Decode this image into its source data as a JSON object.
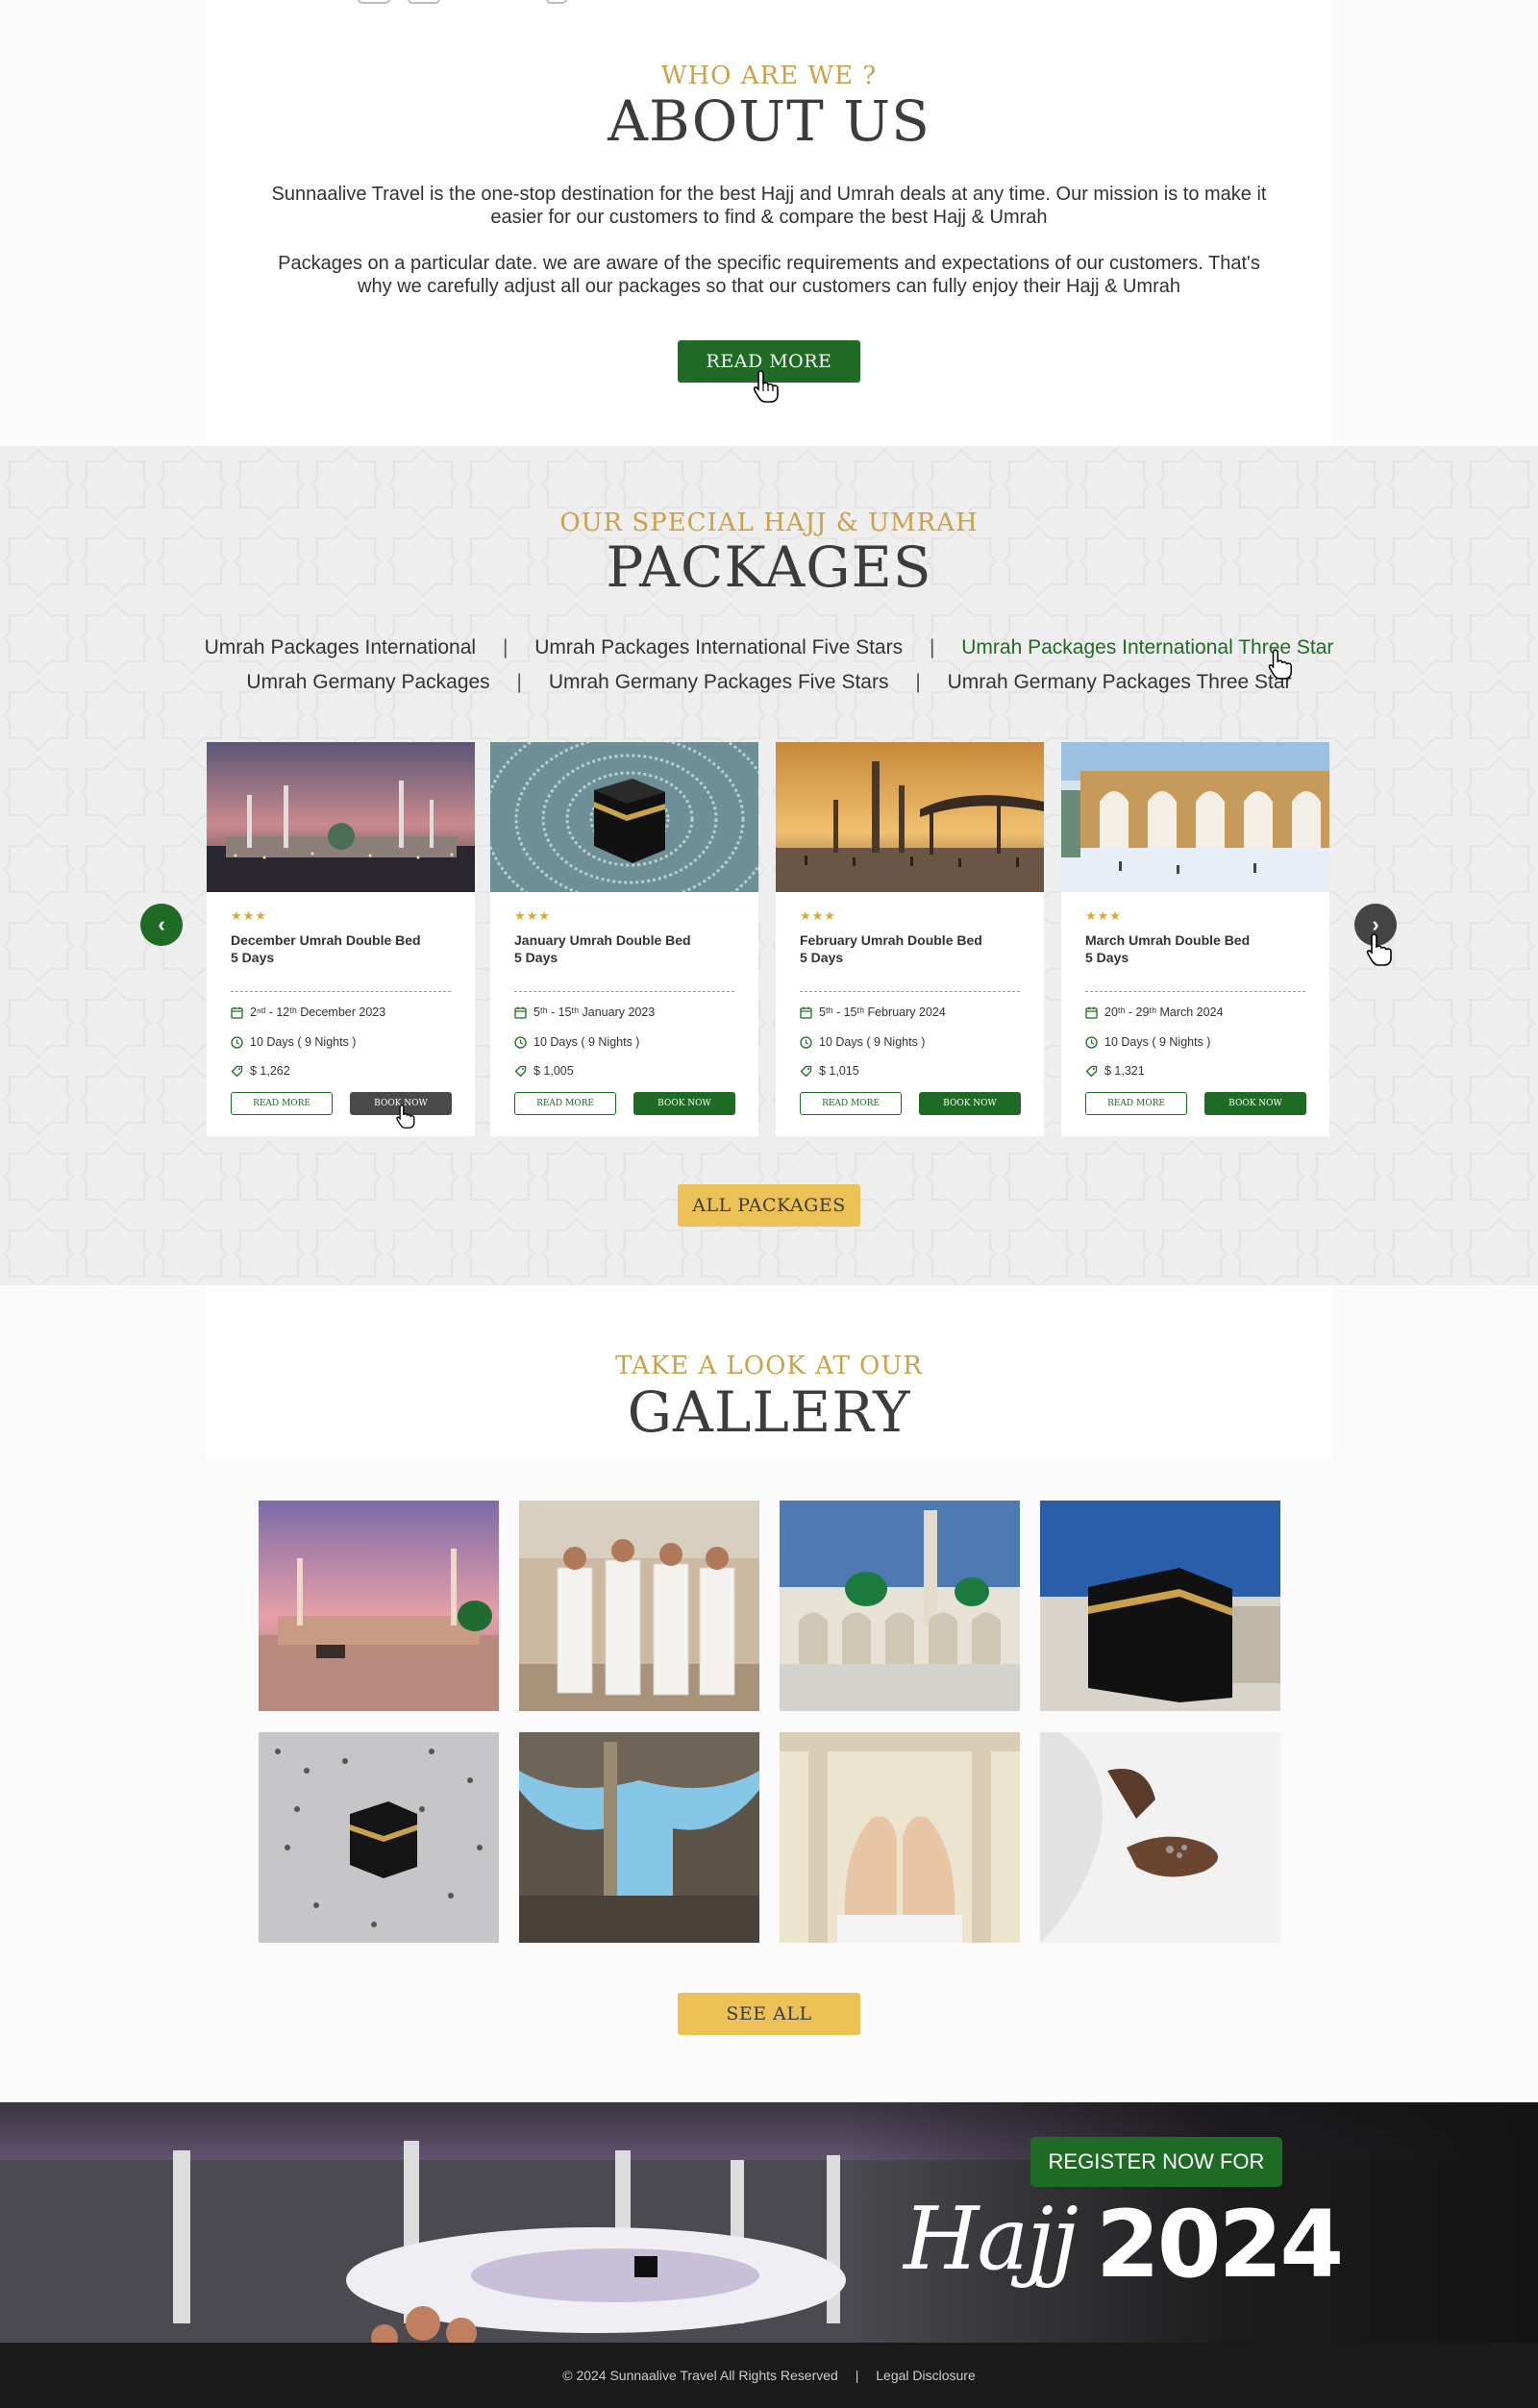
{
  "about": {
    "eyebrow": "WHO ARE WE ?",
    "title": "ABOUT US",
    "paragraph1": "Sunnaalive Travel is the one-stop destination for the best Hajj and Umrah deals at any time. Our mission is to make it easier for our customers to find & compare the best Hajj & Umrah",
    "paragraph2": "Packages on a particular date. we are aware of the specific requirements and expectations of our customers. That's why we carefully adjust all our packages so that our customers can fully enjoy their Hajj & Umrah",
    "button": "READ MORE"
  },
  "packages": {
    "eyebrow": "OUR SPECIAL HAJJ & UMRAH",
    "title": "PACKAGES",
    "tabs_row1": [
      "Umrah Packages International",
      "Umrah Packages International Five Stars",
      "Umrah Packages International Three Star"
    ],
    "tabs_row2": [
      "Umrah Germany Packages",
      "Umrah Germany Packages Five Stars",
      "Umrah Germany Packages Three Star"
    ],
    "separator": "|",
    "active_tab": "Umrah Packages International Three Star",
    "prev_arrow": "‹",
    "next_arrow": "›",
    "cards": [
      {
        "stars": "★★★",
        "title": "December Umrah Double Bed",
        "subtitle": "5 Days",
        "dates": "2ⁿᵈ - 12ᵗʰ December 2023",
        "duration": "10 Days ( 9 Nights )",
        "price": "$ 1,262",
        "read_more": "READ MORE",
        "book_now": "BOOK NOW"
      },
      {
        "stars": "★★★",
        "title": "January Umrah Double Bed",
        "subtitle": "5 Days",
        "dates": "5ᵗʰ - 15ᵗʰ January 2023",
        "duration": "10 Days ( 9 Nights )",
        "price": "$ 1,005",
        "read_more": "READ MORE",
        "book_now": "BOOK NOW"
      },
      {
        "stars": "★★★",
        "title": "February Umrah Double Bed",
        "subtitle": "5 Days",
        "dates": "5ᵗʰ - 15ᵗʰ February 2024",
        "duration": "10 Days ( 9 Nights )",
        "price": "$ 1,015",
        "read_more": "READ MORE",
        "book_now": "BOOK NOW"
      },
      {
        "stars": "★★★",
        "title": "March Umrah Double Bed",
        "subtitle": "5 Days",
        "dates": "20ᵗʰ - 29ᵗʰ March 2024",
        "duration": "10 Days ( 9 Nights )",
        "price": "$ 1,321",
        "read_more": "READ MORE",
        "book_now": "BOOK NOW"
      }
    ],
    "all_button": "ALL PACKAGES"
  },
  "gallery": {
    "eyebrow": "TAKE A LOOK AT OUR",
    "title": "GALLERY",
    "button": "SEE ALL"
  },
  "banner": {
    "register": "REGISTER NOW FOR",
    "word": "Hajj",
    "year": "2024"
  },
  "footer": {
    "copyright": "© 2024 Sunnaalive Travel All Rights Reserved",
    "separator": "|",
    "legal": "Legal Disclosure"
  },
  "colors": {
    "green": "#1f6b25",
    "gold": "#c9a24a",
    "button_gold": "#ecc257",
    "star": "#e0a924"
  }
}
